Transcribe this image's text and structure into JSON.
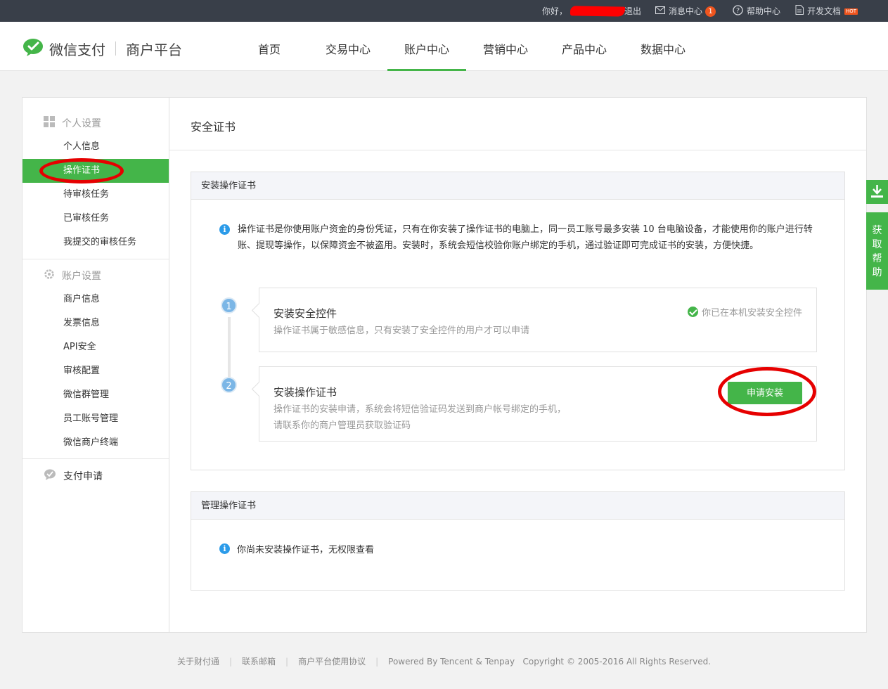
{
  "topbar": {
    "greeting": "你好，",
    "logout": "退出",
    "messages": "消息中心",
    "message_count": "1",
    "help": "帮助中心",
    "docs": "开发文档",
    "docs_badge": "HOT"
  },
  "header": {
    "brand": "微信支付",
    "platform": "商户平台",
    "tabs": [
      "首页",
      "交易中心",
      "账户中心",
      "营销中心",
      "产品中心",
      "数据中心"
    ],
    "active_tab": "账户中心"
  },
  "sidebar": {
    "personal_head": "个人设置",
    "personal_items": [
      "个人信息",
      "操作证书",
      "待审核任务",
      "已审核任务",
      "我提交的审核任务"
    ],
    "account_head": "账户设置",
    "account_items": [
      "商户信息",
      "发票信息",
      "API安全",
      "审核配置",
      "微信群管理",
      "员工账号管理",
      "微信商户终端"
    ],
    "pay_head": "支付申请",
    "active_item": "操作证书"
  },
  "content": {
    "page_title": "安全证书",
    "install_box": {
      "title": "安装操作证书",
      "notice": "操作证书是你使用账户资金的身份凭证，只有在你安装了操作证书的电脑上，同一员工账号最多安装 10 台电脑设备，才能使用你的账户进行转账、提现等操作，以保障资金不被盗用。安装时，系统会短信校验你账户绑定的手机，通过验证即可完成证书的安装，方便快捷。",
      "steps": [
        {
          "num": "1",
          "title": "安装安全控件",
          "desc": "操作证书属于敏感信息，只有安装了安全控件的用户才可以申请",
          "status": "你已在本机安装安全控件"
        },
        {
          "num": "2",
          "title": "安装操作证书",
          "desc_line1": "操作证书的安装申请，系统会将短信验证码发送到商户帐号绑定的手机，",
          "desc_line2": "请联系你的商户管理员获取验证码",
          "button": "申请安装"
        }
      ]
    },
    "manage_box": {
      "title": "管理操作证书",
      "notice": "你尚未安装操作证书，无权限查看"
    }
  },
  "float": {
    "help": "获取帮助"
  },
  "footer": {
    "links": [
      "关于财付通",
      "联系邮箱",
      "商户平台使用协议"
    ],
    "powered": "Powered By Tencent & Tenpay",
    "copyright": "Copyright © 2005-2016 All Rights Reserved."
  },
  "colors": {
    "accent": "#44b549",
    "topbar": "#393f49",
    "info": "#2b9be9",
    "badge": "#f0551e",
    "annotation": "#e60000"
  }
}
